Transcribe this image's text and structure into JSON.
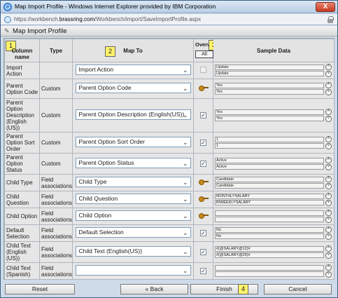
{
  "window": {
    "title": "Map Import Profile - Windows Internet Explorer provided by IBM Corporation",
    "url_prefix": "https://workbench.",
    "url_domain": "brassring.com",
    "url_suffix": "/Workbench/import/SaveImportProfile.aspx",
    "close_label": "X"
  },
  "panel": {
    "title": "Map Import Profile"
  },
  "headers": {
    "column_name": "Column name",
    "type": "Type",
    "map_to": "Map To",
    "overwrite": "Overwrite",
    "all": "All",
    "sample_data": "Sample Data"
  },
  "badges": [
    "1",
    "2",
    "3",
    "4"
  ],
  "rows": [
    {
      "name": "Import Action",
      "type": "",
      "map": "Import Action",
      "over": "disabled",
      "samples": [
        "Update",
        "Update"
      ]
    },
    {
      "name": "Parent Option Code",
      "type": "Custom",
      "map": "Parent Option Code",
      "over": "key",
      "samples": [
        "Yes",
        "Yes"
      ]
    },
    {
      "name": "Parent Option Description (English (US))",
      "type": "Custom",
      "map": "Parent Option Description (English(US))",
      "over": "checked",
      "samples": [
        "Yes",
        "Yes"
      ]
    },
    {
      "name": "Parent Option Sort Order",
      "type": "Custom",
      "map": "Parent Option Sort Order",
      "over": "checked",
      "samples": [
        "1",
        "1"
      ]
    },
    {
      "name": "Parent Option Status",
      "type": "Custom",
      "map": "Parent Option Status",
      "over": "checked",
      "samples": [
        "Active",
        "Active"
      ]
    },
    {
      "name": "Child Type",
      "type": "Field associations",
      "map": "Child Type",
      "over": "key",
      "samples": [
        "Candidate",
        "Candidate"
      ]
    },
    {
      "name": "Child Question",
      "type": "Field associations",
      "map": "Child Question",
      "over": "key",
      "samples": [
        "MONTHLYSALARY",
        "BIWEEKLYSALARY"
      ]
    },
    {
      "name": "Child Option",
      "type": "Field associations",
      "map": "Child Option",
      "over": "key",
      "samples": [
        "",
        ""
      ]
    },
    {
      "name": "Default Selection",
      "type": "Field associations",
      "map": "Default Selection",
      "over": "checked",
      "samples": [
        "No",
        "No"
      ]
    },
    {
      "name": "Child Text (English (US))",
      "type": "Field associations",
      "map": "Child Text (English(US))",
      "over": "checked",
      "samples": [
        "#(@SALARY@12)#",
        "#(@SALARY@26)#"
      ]
    },
    {
      "name": "Child Text (Spanish)",
      "type": "Field associations",
      "map": "",
      "over": "checked",
      "samples": [
        "",
        ""
      ]
    }
  ],
  "footer": {
    "reset": "Reset",
    "back": "« Back",
    "finish": "Finish",
    "cancel": "Cancel"
  },
  "colors": {
    "frame": "#cfdbe9",
    "badge": "#fff36a",
    "key": "#c88a1c"
  }
}
